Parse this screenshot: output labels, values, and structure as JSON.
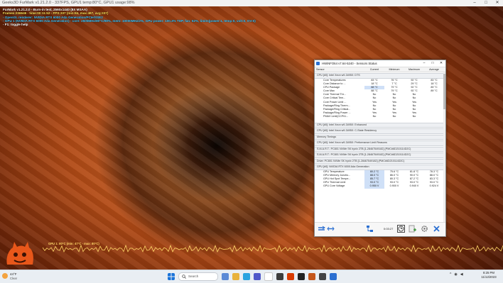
{
  "app": {
    "title": "Geeks3D FurMark v1.21.2.0 - 337FPS, GPU1 temp:80°C, GPU1 usage:98%"
  },
  "furmark_osd": {
    "lines": [
      {
        "text": "FurMark v1.21.2.0 - Burn-in test, 2560x1440 (8X MSAA)",
        "color": "#ffffff"
      },
      {
        "text": "Frames:236646 - time:00:11:52 - FPS:337 (min:84, max:487, avg:337)",
        "color": "#ffe45a"
      },
      {
        "text": "- OpenGL renderer: NVIDIA RTX 6000 Ada Generation/PCIe/SSE2",
        "color": "#3fc8ff"
      },
      {
        "text": "- GPU 1 (NVIDIA RTX 6000 Ada Generation) - core: 2505MHz/80°C/98%, mem: 10000MHz/2%, GPU power: 100.3% TDP, fan: 52%, limits(power:1, temp:0, volt:0, OV:0)",
        "color": "#3fc8ff"
      },
      {
        "text": "- F1: toggle help",
        "color": "#ffffff"
      }
    ],
    "gpu_monitor": "GPU 1: 80°C (min: 47°C - max: 80°C)"
  },
  "hwinfo": {
    "title": "HWiNFO64 v7.64-5240 - Sensors Status",
    "columns": [
      "Sensor",
      "Current",
      "Minimum",
      "Maximum",
      "Average"
    ],
    "cpu_group": "CPU [#0]: Intel Xeon w9-3495X: DTS",
    "cpu_rows": [
      [
        "Core Temperatures",
        "83 °C",
        "76 °C",
        "92 °C",
        "83 °C"
      ],
      [
        "Core Distance to ...",
        "18 °C",
        "7 °C",
        "29 °C",
        "18 °C"
      ],
      [
        "CPU Package",
        "88 °C",
        "79 °C",
        "92 °C",
        "89 °C"
      ],
      [
        "Core Max",
        "88 °C",
        "79 °C",
        "92 °C",
        "89 °C"
      ],
      [
        "Core Thermal Thr...",
        "No",
        "No",
        "No",
        ""
      ],
      [
        "Core Critical Tem...",
        "No",
        "No",
        "No",
        ""
      ],
      [
        "Core Power Limit ...",
        "Yes",
        "Yes",
        "Yes",
        ""
      ],
      [
        "Package/Ring Therm...",
        "No",
        "No",
        "No",
        ""
      ],
      [
        "Package/Ring Critical...",
        "No",
        "No",
        "No",
        ""
      ],
      [
        "Package/Ring Power ...",
        "Yes",
        "Yes",
        "Yes",
        ""
      ],
      [
        "PMAX Limit(CCP/U...",
        "No",
        "No",
        "No",
        ""
      ]
    ],
    "groups": [
      "CPU [#0]: Intel Xeon w9-3495X: Enhanced",
      "CPU [#0]: Intel Xeon w9-3495X: C-State Residency",
      "Memory Timings",
      "CPU [#0]: Intel Xeon w9-3495X: Performance Limit Reasons",
      "S.M.A.R.T.: PC801 NVMe SK hynix 2TB [1-28467549182]  (PMC#6D210114D2C)",
      "S.M.A.R.T.: PC801 NVMe SK hynix 2TB [1-28467549182]  (PMC#6D210114D2C)",
      "Drive: PC801 NVMe SK hynix 2TB [1-28467549182]  (PMC#6D210114D2C)"
    ],
    "gpu_group": "GPU [#0]: NVIDIA RTX 6000 Ada Generation",
    "gpu_rows": [
      [
        "GPU Temperature",
        "80.2 °C",
        "75.6 °C",
        "81.8 °C",
        "78.3 °C"
      ],
      [
        "GPU Memory Junctio...",
        "88.0 °C",
        "86.0 °C",
        "90.0 °C",
        "88.0 °C"
      ],
      [
        "GPU Hot Spot Tempe...",
        "85.7 °C",
        "80.3 °C",
        "87.2 °C",
        "83.3 °C"
      ],
      [
        "GPU Thermal Limit",
        "93.0 °C",
        "93.0 °C",
        "93.0 °C",
        "93.0 °C"
      ],
      [
        "GPU Core Voltage",
        "0.950 V",
        "0.900 V",
        "0.940 V",
        "0.924 V"
      ]
    ],
    "timer": "0:03:27"
  },
  "taskbar": {
    "weather_temp": "44°F",
    "weather_desc": "Clear",
    "search_placeholder": "Search",
    "time": "8:25 PM",
    "date": "11/12/2023"
  }
}
